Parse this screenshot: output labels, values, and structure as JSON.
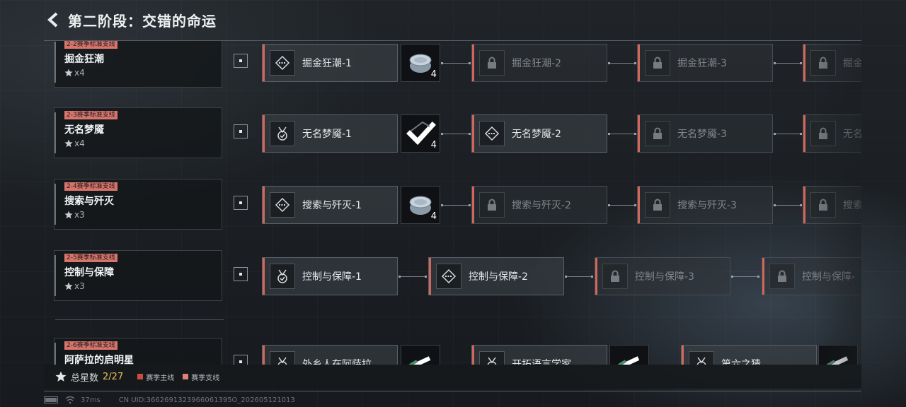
{
  "header": {
    "title": "第二阶段：交错的命运"
  },
  "rows": [
    {
      "tag": "2-2赛季标准支线",
      "name": "掘金狂潮",
      "stars": "x4",
      "nodes": [
        "掘金狂潮-1",
        "掘金狂潮-2",
        "掘金狂潮-3",
        "掘金"
      ],
      "reward_qty": "4"
    },
    {
      "tag": "2-3赛季标准支线",
      "name": "无名梦魇",
      "stars": "x4",
      "nodes": [
        "无名梦魇-1",
        "无名梦魇-2",
        "无名梦魇-3",
        "无名"
      ],
      "reward_qty": "4"
    },
    {
      "tag": "2-4赛季标准支线",
      "name": "搜索与歼灭",
      "stars": "x3",
      "nodes": [
        "搜索与歼灭-1",
        "搜索与歼灭-2",
        "搜索与歼灭-3",
        "搜索"
      ],
      "reward_qty": "4"
    },
    {
      "tag": "2-5赛季标准支线",
      "name": "控制与保障",
      "stars": "x3",
      "nodes": [
        "控制与保障-1",
        "控制与保障-2",
        "控制与保障-3",
        "控制与保障-"
      ]
    },
    {
      "tag": "2-6赛季标准支线",
      "name": "阿萨拉的启明星",
      "stars": "",
      "nodes": [
        "外乡人在阿萨拉",
        "开拓语言学家",
        "第六之猜"
      ]
    }
  ],
  "footer": {
    "total_label": "总星数",
    "total_value": "2/27",
    "legend_main": "赛季主线",
    "legend_branch": "赛季支线"
  },
  "status": {
    "ping": "37ms",
    "uid": "CN UID:3662691323966061395O_202605121013"
  },
  "colors": {
    "accent": "#d1665c",
    "star_count": "#e7c35a"
  }
}
